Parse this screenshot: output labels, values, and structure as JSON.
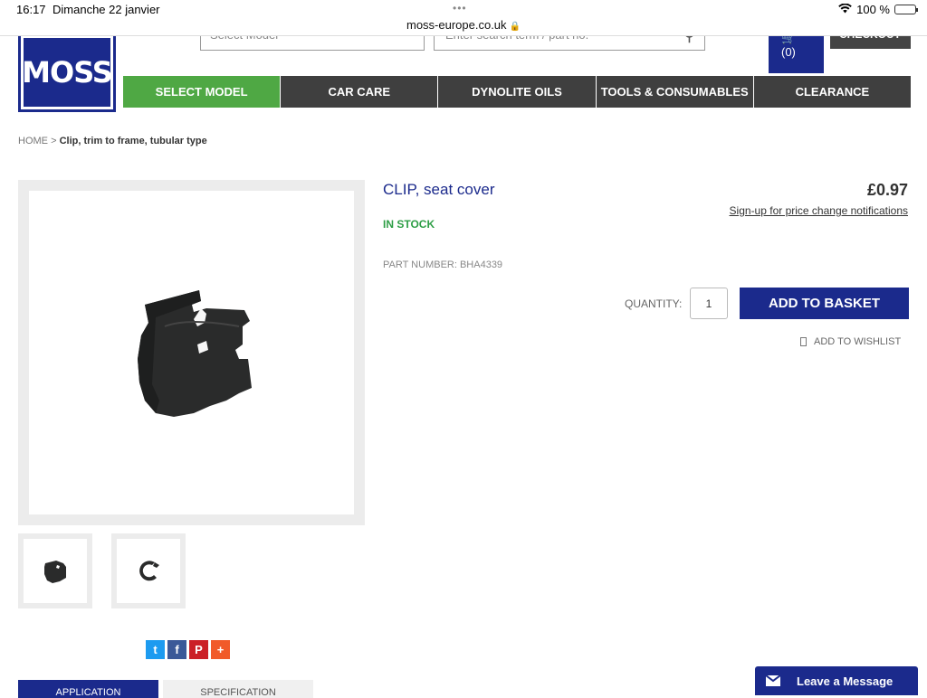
{
  "status_bar": {
    "time": "16:17",
    "date": "Dimanche 22 janvier",
    "dots": "•••",
    "url": "moss-europe.co.uk",
    "battery": "100 %",
    "battery_level": 1.0
  },
  "header": {
    "logo_text": "MOSS",
    "model_select_placeholder": "Select Model",
    "search_placeholder": "Enter search term / part no.",
    "cart_count": "(0)",
    "checkout_label": "CHECKOUT"
  },
  "nav": [
    {
      "label": "SELECT MODEL"
    },
    {
      "label": "CAR CARE"
    },
    {
      "label": "DYNOLITE OILS"
    },
    {
      "label": "TOOLS & CONSUMABLES"
    },
    {
      "label": "CLEARANCE"
    }
  ],
  "breadcrumb": {
    "home": "HOME",
    "separator": ">",
    "current": "Clip, trim to frame, tubular type"
  },
  "product": {
    "title": "CLIP, seat cover",
    "price": "£0.97",
    "signup_link": "Sign-up for price change notifications",
    "stock": "IN STOCK",
    "part_number": "PART NUMBER: BHA4339",
    "quantity_label": "QUANTITY:",
    "quantity_value": "1",
    "add_to_basket": "ADD TO BASKET",
    "add_to_wishlist": "ADD TO WISHLIST"
  },
  "tabs": [
    {
      "label": "APPLICATION"
    },
    {
      "label": "SPECIFICATION"
    }
  ],
  "chat": {
    "label": "Leave a Message"
  },
  "colors": {
    "brand_blue": "#1b2a8c",
    "nav_green": "#4fa844",
    "nav_dark": "#3f3f3f",
    "stock_green": "#2e9e46"
  }
}
